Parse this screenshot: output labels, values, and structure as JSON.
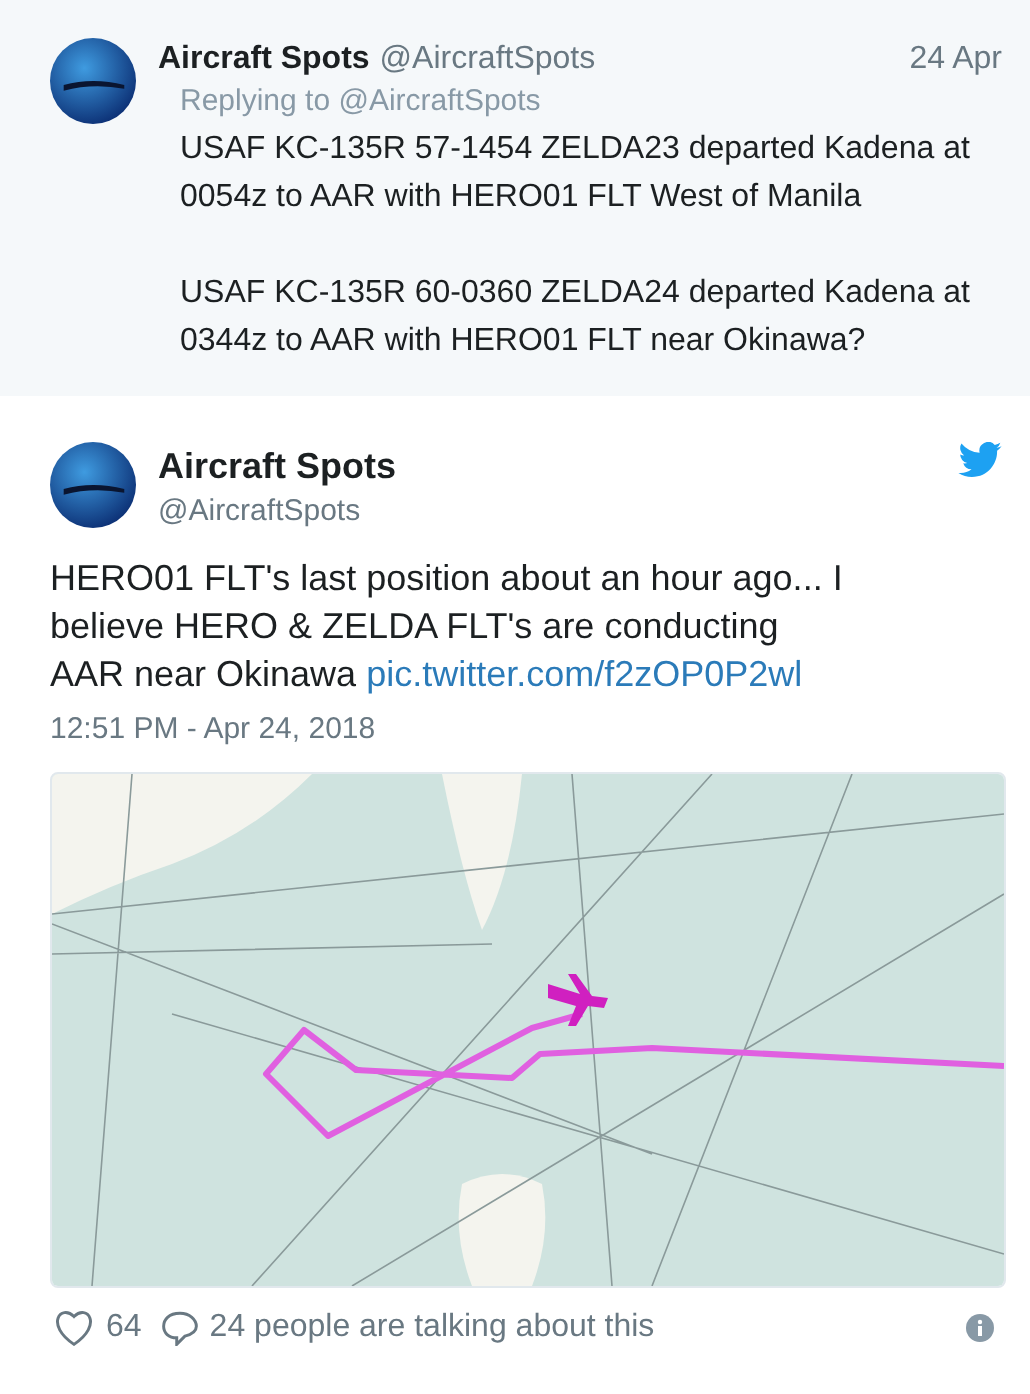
{
  "reply_tweet": {
    "name": "Aircraft Spots",
    "handle": "@AircraftSpots",
    "date": "24 Apr",
    "replying_to": "Replying to @AircraftSpots",
    "paragraphs": [
      "USAF KC-135R 57-1454 ZELDA23 departed Kadena at 0054z to AAR with HERO01 FLT West of Manila",
      "USAF KC-135R 60-0360 ZELDA24 departed Kadena at 0344z to AAR with HERO01 FLT near Okinawa?"
    ]
  },
  "tweet": {
    "name": "Aircraft Spots",
    "handle": "@AircraftSpots",
    "text": "HERO01 FLT's last position about an hour ago... I believe HERO & ZELDA FLT's are conducting AAR near Okinawa",
    "link": "pic.twitter.com/f2zOP0P2wl",
    "timestamp": "12:51 PM - Apr 24, 2018",
    "likes": "64",
    "talking": "24 people are talking about this"
  }
}
